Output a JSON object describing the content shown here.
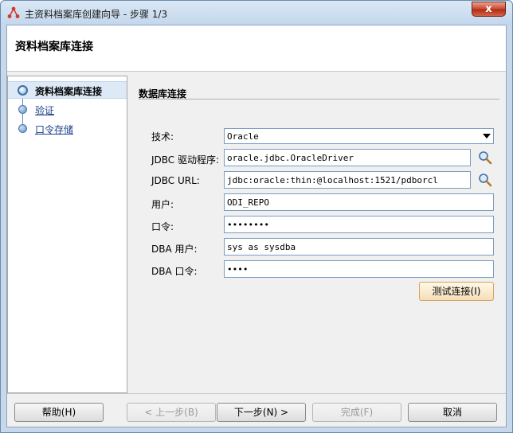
{
  "window": {
    "title": "主资料档案库创建向导 - 步骤 1/3",
    "close_label": "x"
  },
  "header": {
    "title": "资料档案库连接"
  },
  "nav": {
    "items": [
      {
        "label": "资料档案库连接",
        "active": true
      },
      {
        "label": "验证",
        "active": false
      },
      {
        "label": "口令存储",
        "active": false
      }
    ]
  },
  "form": {
    "section_title": "数据库连接",
    "tech_label": "技术:",
    "tech_value": "Oracle",
    "driver_label": "JDBC 驱动程序:",
    "driver_value": "oracle.jdbc.OracleDriver",
    "url_label": "JDBC URL:",
    "url_value": "jdbc:oracle:thin:@localhost:1521/pdborcl",
    "user_label": "用户:",
    "user_value": "ODI_REPO",
    "password_label": "口令:",
    "password_value": "••••••••",
    "dba_user_label": "DBA 用户:",
    "dba_user_value": "sys as sysdba",
    "dba_password_label": "DBA 口令:",
    "dba_password_value": "••••",
    "test_button": "测试连接(I)"
  },
  "footer": {
    "help": "帮助(H)",
    "back": "< 上一步(B)",
    "next": "下一步(N) >",
    "finish": "完成(F)",
    "cancel": "取消"
  }
}
